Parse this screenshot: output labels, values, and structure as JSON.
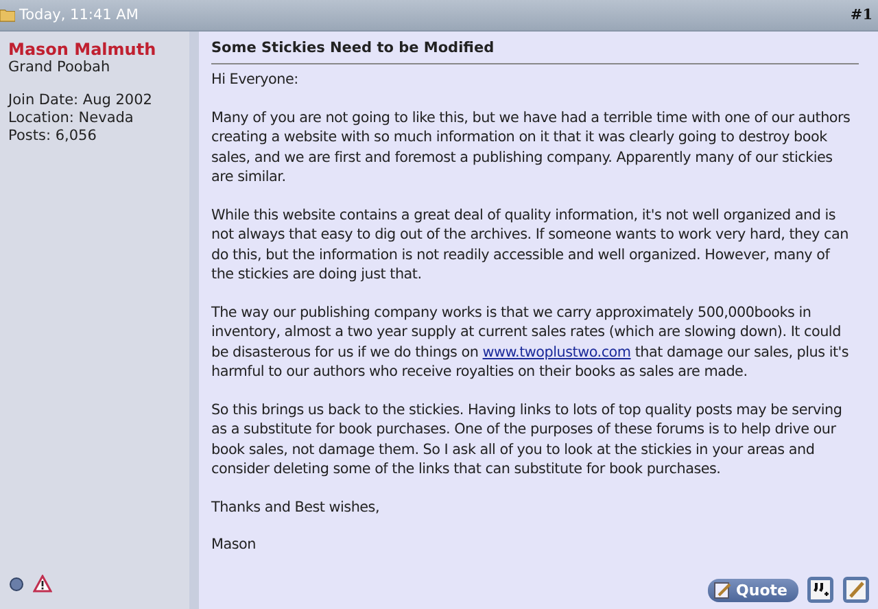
{
  "header": {
    "date": "Today, 11:41 AM",
    "post_number": "#1"
  },
  "user": {
    "name": "Mason Malmuth",
    "rank": "Grand Poobah",
    "details": [
      "Join Date: Aug 2002",
      "Location: Nevada",
      "Posts: 6,056"
    ]
  },
  "post": {
    "title": "Some Stickies Need to be Modified",
    "paragraphs": [
      [
        {
          "kind": "text",
          "text": "Hi Everyone:"
        }
      ],
      [
        {
          "kind": "text",
          "text": "Many of you are not going to like this, but we have had a terrible time with one of our authors creating a website with so much information on it that it was clearly going to destroy book sales, and we are first and foremost a publishing company. Apparently many of our stickies are similar."
        }
      ],
      [
        {
          "kind": "text",
          "text": "While this website contains a great deal of quality information, it's not well organized and is not always that easy to dig out of the archives. If someone wants to work very hard, they can do this, but the information is not readily accessible and well organized. However, many of the stickies are doing just that."
        }
      ],
      [
        {
          "kind": "text",
          "text": "The way our publishing company works is that we carry approximately 500,000books in inventory, almost a two year supply at current sales rates (which are slowing down). It could be disasterous for us if we do things on "
        },
        {
          "kind": "link",
          "text": "www.twoplustwo.com"
        },
        {
          "kind": "text",
          "text": " that damage our sales, plus it's harmful to our authors who receive royalties on their books as sales are made."
        }
      ],
      [
        {
          "kind": "text",
          "text": "So this brings us back to the stickies. Having links to lots of top quality posts may be serving as a substitute for book purchases. One of the purposes of these forums is to help drive our book sales, not damage them. So I ask all of you to look at the stickies in your areas and consider deleting some of the links that can substitute for book purchases."
        }
      ],
      [
        {
          "kind": "text",
          "text": "Thanks and Best wishes,"
        }
      ],
      [
        {
          "kind": "text",
          "text": "Mason"
        }
      ]
    ]
  },
  "buttons": {
    "quote": "Quote"
  }
}
